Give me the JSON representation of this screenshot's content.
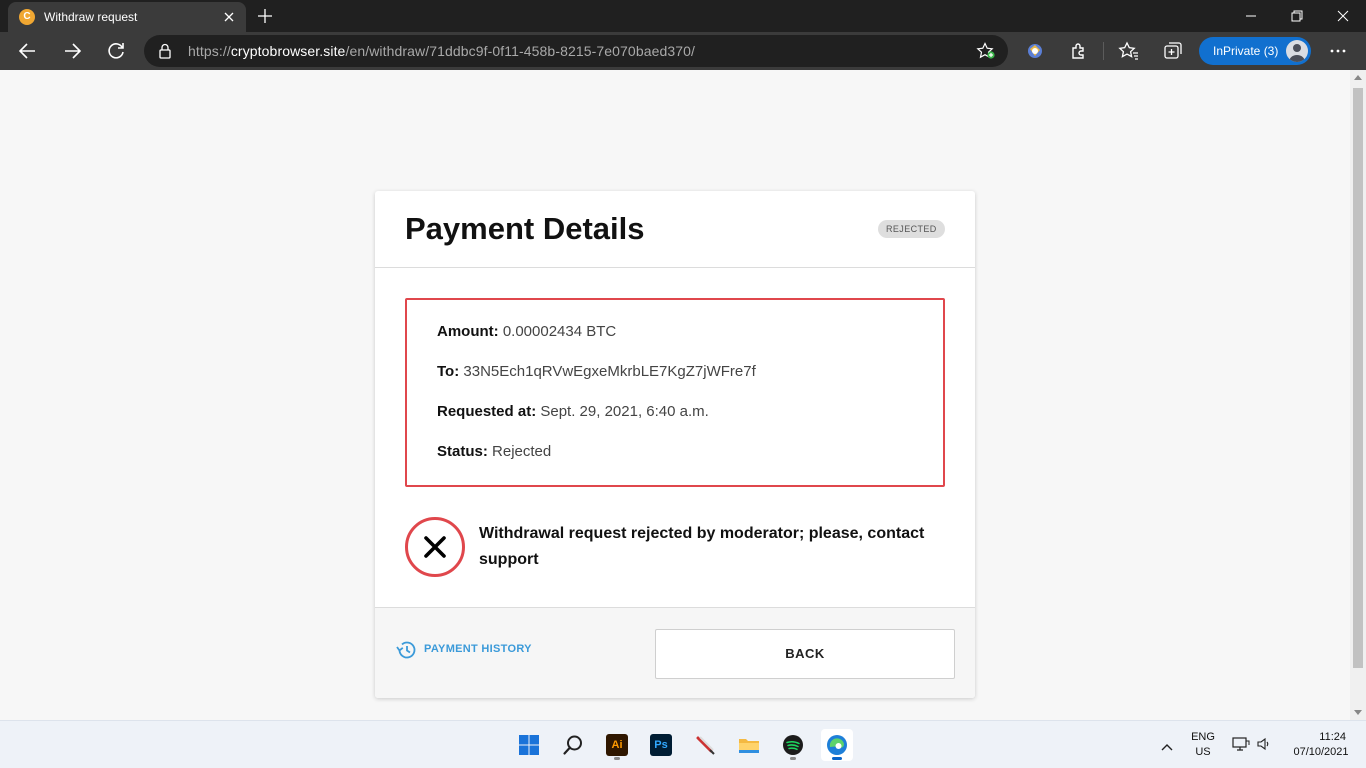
{
  "browser": {
    "tab_title": "Withdraw request",
    "favicon_letter": "C",
    "url_scheme": "https://",
    "url_host": "cryptobrowser.site",
    "url_path": "/en/withdraw/71ddbc9f-0f11-458b-8215-7e070baed370/",
    "inprivate_label": "InPrivate (3)"
  },
  "page": {
    "title": "Payment Details",
    "status_badge": "REJECTED",
    "details": {
      "amount_label": "Amount:",
      "amount_value": "0.00002434 BTC",
      "to_label": "To:",
      "to_value": "33N5Ech1qRVwEgxeMkrbLE7KgZ7jWFre7f",
      "requested_label": "Requested at:",
      "requested_value": "Sept. 29, 2021, 6:40 a.m.",
      "status_label": "Status:",
      "status_value": "Rejected"
    },
    "alert_message": "Withdrawal request rejected by moderator; please, contact support",
    "history_link": "PAYMENT HISTORY",
    "back_button": "BACK"
  },
  "taskbar": {
    "apps": [
      "start-icon",
      "search-icon",
      "illustrator-icon",
      "photoshop-icon",
      "pen-icon",
      "file-explorer-icon",
      "spotify-icon",
      "edge-icon"
    ],
    "illustrator_letters": "Ai",
    "photoshop_letters": "Ps",
    "lang_line1": "ENG",
    "lang_line2": "US",
    "time": "11:24",
    "date": "07/10/2021"
  },
  "colors": {
    "reject_red": "#e0474c",
    "link_blue": "#3b9ad9",
    "inprivate_blue": "#1170cf"
  }
}
